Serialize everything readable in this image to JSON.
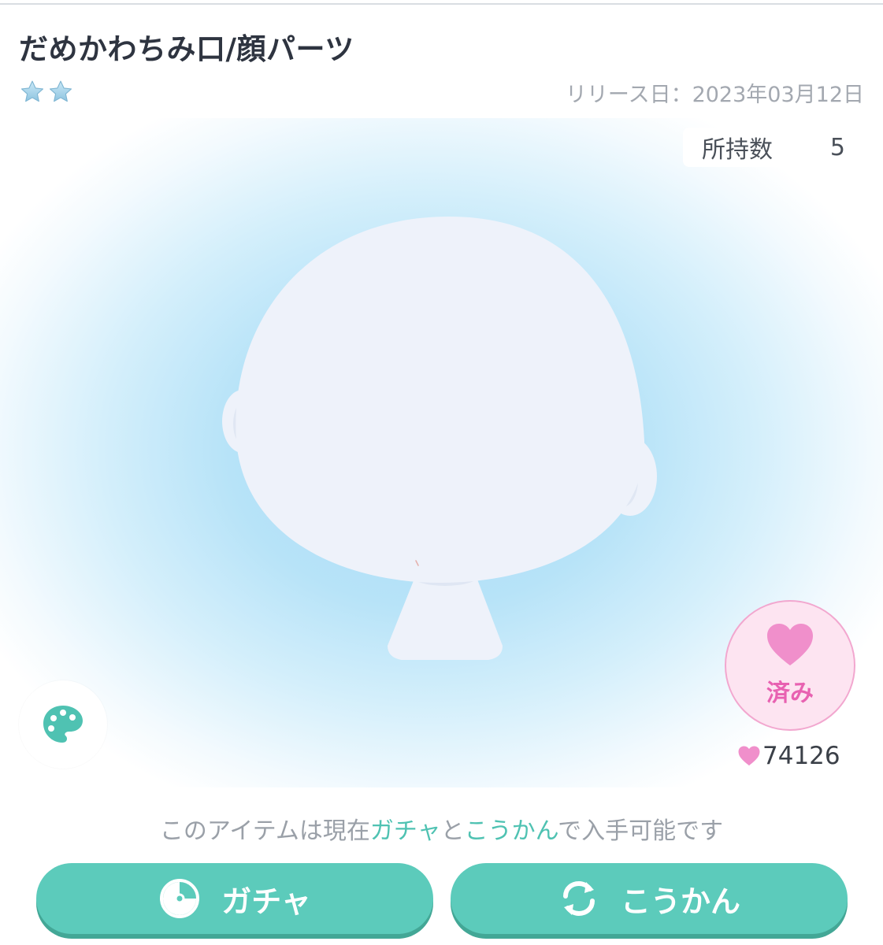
{
  "item": {
    "title": "だめかわちみ口/顔パーツ",
    "rarity_stars": 2,
    "release": "リリース日：2023年03月12日"
  },
  "owned": {
    "label": "所持数",
    "count": "5"
  },
  "like": {
    "state_label": "済み",
    "count": "74126"
  },
  "availability": {
    "prefix": "このアイテムは現在",
    "gacha": "ガチャ",
    "conjunction": "と",
    "exchange": "こうかん",
    "suffix": "で入手可能です"
  },
  "buttons": {
    "gacha": "ガチャ",
    "exchange": "こうかん"
  },
  "colors": {
    "accent": "#5ccbbb",
    "accent_text": "#4fc2b2",
    "like_pink": "#f08fcb",
    "like_bg": "#fde4f1",
    "stage_blue": "#a9ddf7"
  },
  "icons": {
    "rarity": "star-icon",
    "palette": "palette-icon",
    "like": "heart-icon",
    "gacha": "gacha-capsule-icon",
    "exchange": "exchange-icon"
  }
}
